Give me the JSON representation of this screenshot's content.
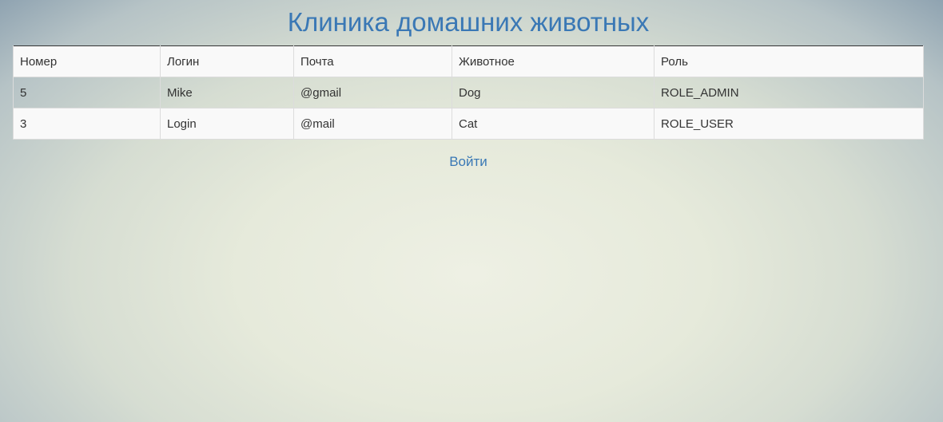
{
  "title": "Клиника домашних животных",
  "table": {
    "headers": [
      "Номер",
      "Логин",
      "Почта",
      "Животное",
      "Роль"
    ],
    "rows": [
      [
        "5",
        "Mike",
        "@gmail",
        "Dog",
        "ROLE_ADMIN"
      ],
      [
        "3",
        "Login",
        "@mail",
        "Cat",
        "ROLE_USER"
      ]
    ]
  },
  "login_link": "Войти",
  "colors": {
    "accent": "#3a78b5",
    "text": "#333333"
  }
}
